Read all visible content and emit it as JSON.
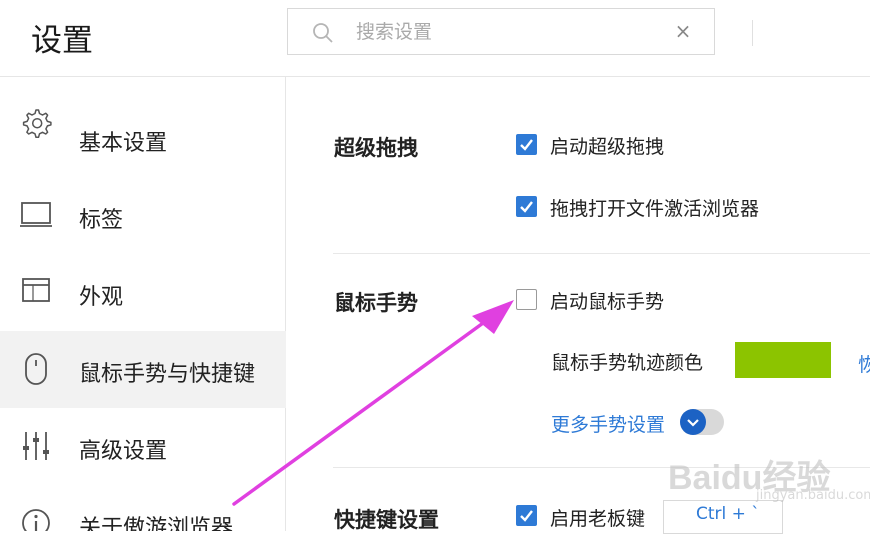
{
  "header": {
    "title": "设置",
    "search_placeholder": "搜索设置",
    "clear_glyph": "×"
  },
  "sidebar": {
    "items": [
      {
        "label": "基本设置",
        "icon": "gear-icon"
      },
      {
        "label": "标签",
        "icon": "tab-icon"
      },
      {
        "label": "外观",
        "icon": "window-icon"
      },
      {
        "label": "鼠标手势与快捷键",
        "icon": "mouse-icon",
        "active": true
      },
      {
        "label": "高级设置",
        "icon": "sliders-icon"
      },
      {
        "label": "关于傲游浏览器",
        "icon": "info-icon"
      }
    ]
  },
  "main": {
    "super_drag": {
      "title": "超级拖拽",
      "options": [
        {
          "label": "启动超级拖拽",
          "checked": true
        },
        {
          "label": "拖拽打开文件激活浏览器",
          "checked": true
        }
      ]
    },
    "mouse_gesture": {
      "title": "鼠标手势",
      "enable": {
        "label": "启动鼠标手势",
        "checked": false
      },
      "trail_color_label": "鼠标手势轨迹颜色",
      "trail_color": "#8cc400",
      "restore_label": "恢",
      "more_link": "更多手势设置"
    },
    "hotkeys": {
      "title": "快捷键设置",
      "boss_key": {
        "label": "启用老板键",
        "checked": true
      },
      "boss_key_value": "Ctrl + `"
    }
  },
  "watermark": {
    "brand": "Baidu经验",
    "sub": "jingyan.baidu.com"
  },
  "colors": {
    "accent": "#2e7ad6",
    "annotation_arrow": "#e040e0"
  }
}
